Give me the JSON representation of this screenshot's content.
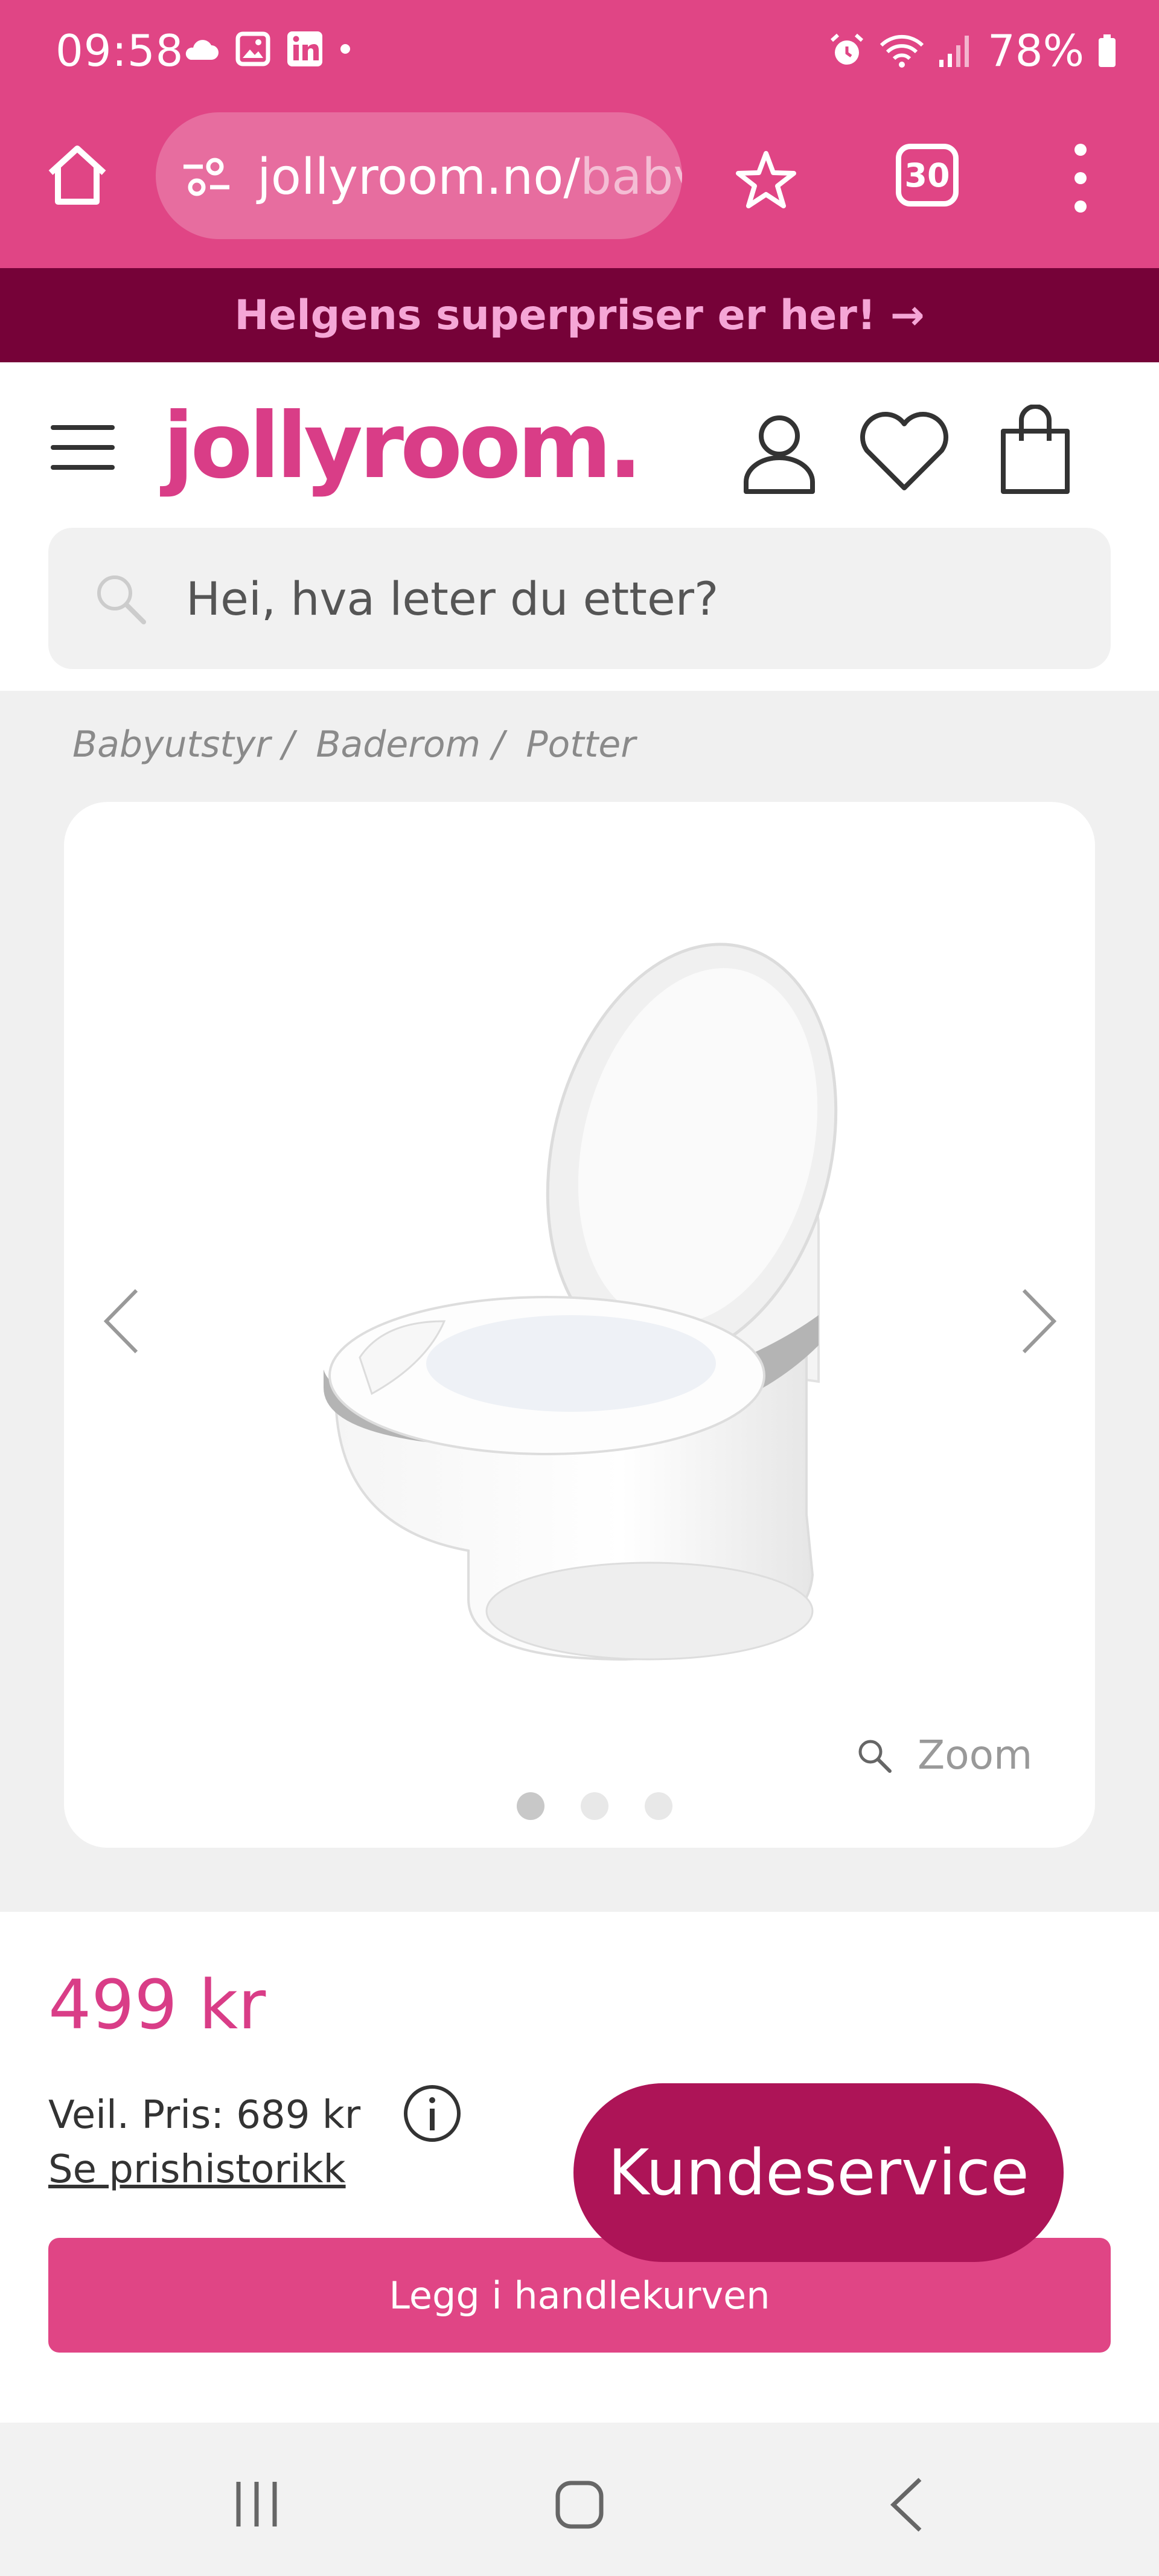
{
  "status_bar": {
    "time": "09:58",
    "battery": "78%"
  },
  "browser": {
    "url_domain": "jollyroom.no/",
    "url_rest": "baby",
    "tab_count": "30"
  },
  "promo": {
    "text": "Helgens superpriser er her! →"
  },
  "header": {
    "logo": "jollyroom.",
    "search_placeholder": "Hei, hva leter du etter?"
  },
  "breadcrumb": [
    "Babyutstyr /",
    "Baderom /",
    "Potter"
  ],
  "gallery": {
    "zoom_label": "Zoom",
    "slide_count": 3,
    "active_slide": 1
  },
  "product": {
    "price": "499 kr",
    "recommended_price": "Veil. Pris: 689 kr",
    "price_history_link": "Se prishistorikk",
    "add_to_cart": "Legg i handlekurven"
  },
  "support_button": "Kundeservice",
  "colors": {
    "brand_pink": "#e04585",
    "banner_dark": "#760238",
    "promo_text": "#f5a6d6",
    "support_bg": "#ad1457"
  }
}
